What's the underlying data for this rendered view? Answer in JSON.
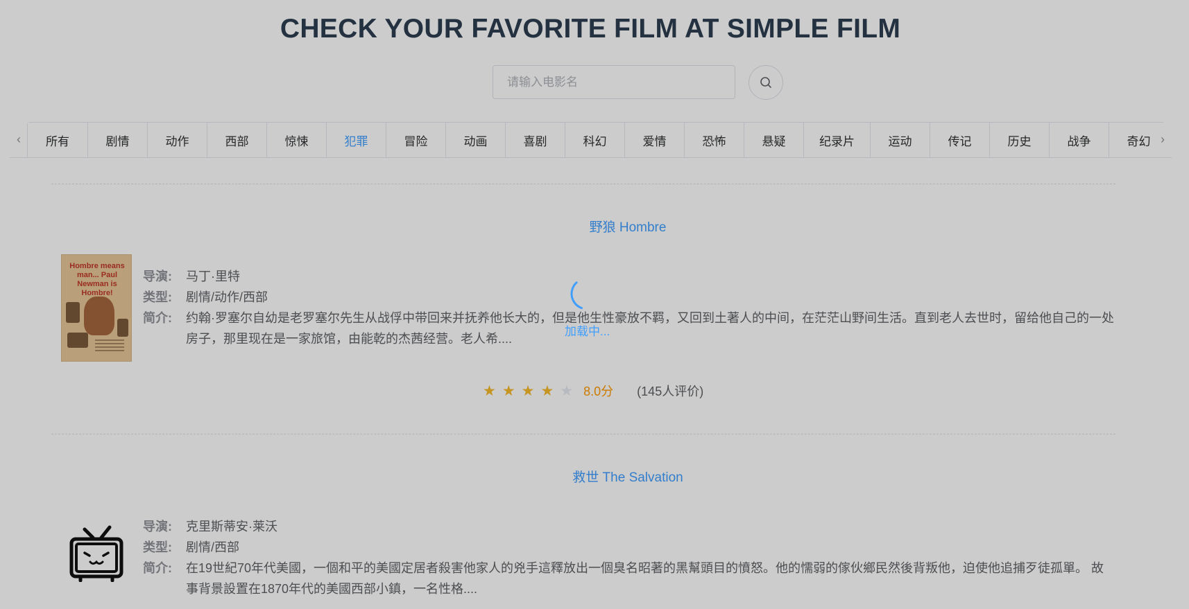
{
  "header": {
    "title": "CHECK YOUR FAVORITE FILM AT SIMPLE FILM"
  },
  "search": {
    "placeholder": "请输入电影名"
  },
  "tabs": {
    "active": "犯罪",
    "items": [
      "所有",
      "剧情",
      "动作",
      "西部",
      "惊悚",
      "犯罪",
      "冒险",
      "动画",
      "喜剧",
      "科幻",
      "爱情",
      "恐怖",
      "悬疑",
      "纪录片",
      "运动",
      "传记",
      "历史",
      "战争",
      "奇幻"
    ]
  },
  "labels": {
    "director": "导演:",
    "genre": "类型:",
    "summary": "简介:"
  },
  "films": [
    {
      "title": "野狼 Hombre",
      "poster_text": "Hombre means man... Paul Newman is Hombre!",
      "director": "马丁·里特",
      "genre": "剧情/动作/西部",
      "summary": "约翰·罗塞尔自幼是老罗塞尔先生从战俘中带回来并抚养他长大的，但是他生性豪放不羁，又回到土著人的中间，在茫茫山野间生活。直到老人去世时，留给他自己的一处房子，那里现在是一家旅馆，由能乾的杰茜经营。老人希....",
      "rating_stars": 4,
      "rating_max": 5,
      "score_text": "8.0分",
      "count_text": "(145人评价)"
    },
    {
      "title": "救世 The Salvation",
      "poster_icon": "tv-icon",
      "director": "克里斯蒂安·莱沃",
      "genre": "剧情/西部",
      "summary": "在19世紀70年代美國，一個和平的美國定居者殺害他家人的兇手這釋放出一個臭名昭著的黑幫頭目的憤怒。他的懦弱的傢伙鄉民然後背叛他，迫使他追捕歹徒孤單。 故事背景設置在1870年代的美國西部小鎮，一名性格...."
    }
  ],
  "loading": {
    "text": "加载中..."
  },
  "colors": {
    "accent": "#409eff",
    "star_on": "#f7ba2a",
    "star_off": "#e5e9f2",
    "score": "#ff9900",
    "overlay": "rgba(0,0,0,0.2)"
  }
}
